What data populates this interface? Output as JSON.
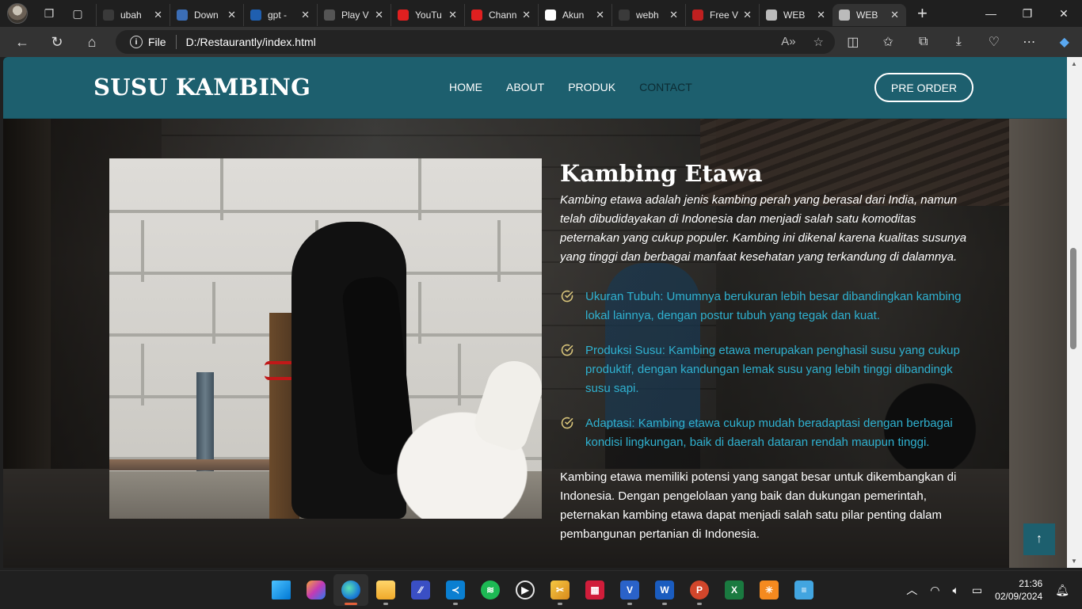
{
  "browser": {
    "tabs": [
      {
        "title": "ubah",
        "favicon_color": "#3a3a3a",
        "favicon": "search-icon"
      },
      {
        "title": "Down",
        "favicon_color": "#3b6db5",
        "favicon": "num-icon"
      },
      {
        "title": "gpt -",
        "favicon_color": "#1f5fb0",
        "favicon": "bing-icon"
      },
      {
        "title": "Play V",
        "favicon_color": "#555555",
        "favicon": "app-icon"
      },
      {
        "title": "YouTu",
        "favicon_color": "#e02020",
        "favicon": "youtube-icon"
      },
      {
        "title": "Chann",
        "favicon_color": "#e02020",
        "favicon": "youtube-icon"
      },
      {
        "title": "Akun",
        "favicon_color": "#ffffff",
        "favicon": "google-icon"
      },
      {
        "title": "webh",
        "favicon_color": "#3a3a3a",
        "favicon": "search-icon"
      },
      {
        "title": "Free V",
        "favicon_color": "#c02020",
        "favicon": "logo-icon"
      },
      {
        "title": "WEB",
        "favicon_color": "#bbbbbb",
        "favicon": "globe-icon"
      },
      {
        "title": "WEB",
        "favicon_color": "#bbbbbb",
        "favicon": "globe-icon"
      }
    ],
    "address_label": "File",
    "url": "D:/Restaurantly/index.html"
  },
  "site": {
    "brand": "SUSU KAMBING",
    "menu": [
      "HOME",
      "ABOUT",
      "PRODUK",
      "CONTACT"
    ],
    "active_menu": "CONTACT",
    "preorder_label": "PRE ORDER"
  },
  "about": {
    "title": "Kambing Etawa",
    "intro_lines": [
      "Kambing etawa adalah jenis kambing perah yang berasal dari India, namun",
      "telah dibudidayakan di Indonesia dan menjadi salah satu komoditas",
      "peternakan yang cukup populer. Kambing ini dikenal karena kualitas susunya",
      "yang tinggi dan berbagai manfaat kesehatan yang terkandung di dalamnya."
    ],
    "features": [
      [
        "Ukuran Tubuh: Umumnya berukuran lebih besar dibandingkan kambing",
        "lokal lainnya, dengan postur tubuh yang tegak dan kuat."
      ],
      [
        "Produksi Susu: Kambing etawa merupakan penghasil susu yang cukup",
        "produktif, dengan kandungan lemak susu yang lebih tinggi dibandingk",
        "susu sapi."
      ],
      [
        "Adaptasi: Kambing etawa cukup mudah beradaptasi dengan berbagai",
        "kondisi lingkungan, baik di daerah dataran rendah maupun tinggi."
      ]
    ],
    "outro_lines": [
      "Kambing etawa memiliki potensi yang sangat besar untuk dikembangkan di",
      "Indonesia. Dengan pengelolaan yang baik dan dukungan pemerintah,",
      "peternakan kambing etawa dapat menjadi salah satu pilar penting dalam",
      "pembangunan pertanian di Indonesia."
    ]
  },
  "taskbar": {
    "time": "21:36",
    "date": "02/09/2024"
  },
  "colors": {
    "header": "#1d5f6e",
    "feature_text": "#2fb1d0",
    "check_icon": "#d8c47a"
  }
}
